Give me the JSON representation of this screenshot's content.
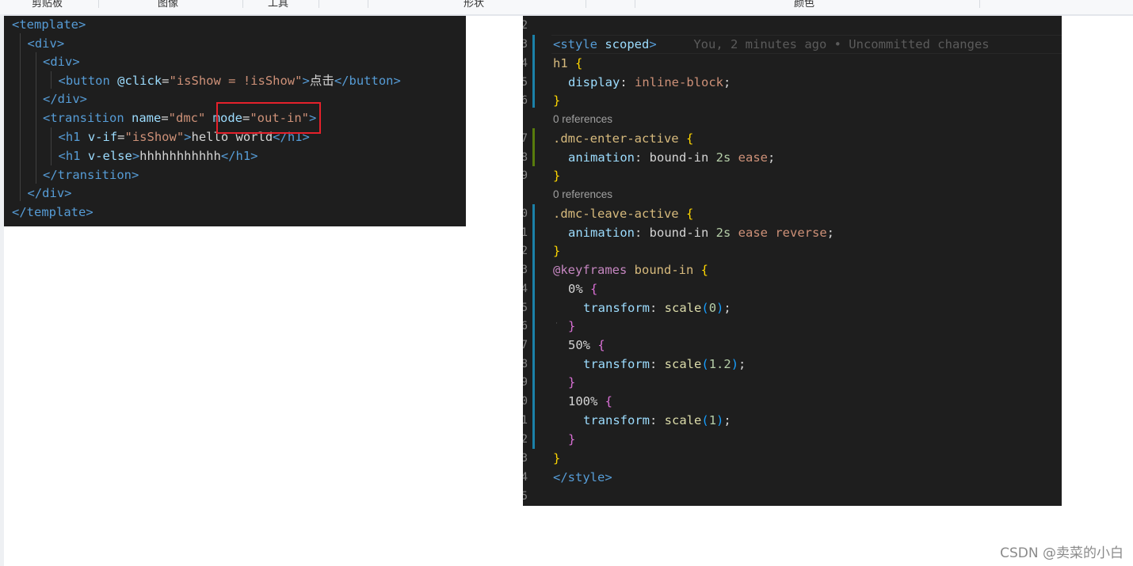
{
  "ribbon": {
    "labels": [
      "剪贴板",
      "图像",
      "工具",
      "形状",
      "颜色"
    ]
  },
  "left_editor": {
    "lines": [
      [
        [
          "tag",
          "<template>"
        ]
      ],
      [
        [
          "tag",
          "<div>"
        ]
      ],
      [
        [
          "tag",
          "<div>"
        ]
      ],
      [
        [
          "tag",
          "<button "
        ],
        [
          "attr",
          "@click"
        ],
        [
          "txt",
          "="
        ],
        [
          "str",
          "\"isShow = !isShow\""
        ],
        [
          "tag",
          ">"
        ],
        [
          "txt",
          "点击"
        ],
        [
          "tag",
          "</button>"
        ]
      ],
      [
        [
          "tag",
          "</div>"
        ]
      ],
      [
        [
          "tag",
          "<transition "
        ],
        [
          "attr",
          "name"
        ],
        [
          "txt",
          "="
        ],
        [
          "str",
          "\"dmc\" "
        ],
        [
          "attr",
          "mode"
        ],
        [
          "txt",
          "="
        ],
        [
          "str",
          "\"out-in\""
        ],
        [
          "tag",
          ">"
        ]
      ],
      [
        [
          "tag",
          "<h1 "
        ],
        [
          "attr",
          "v-if"
        ],
        [
          "txt",
          "="
        ],
        [
          "str",
          "\"isShow\""
        ],
        [
          "tag",
          ">"
        ],
        [
          "txt",
          "hello world"
        ],
        [
          "tag",
          "</h1>"
        ]
      ],
      [
        [
          "tag",
          "<h1 "
        ],
        [
          "attr",
          "v-else"
        ],
        [
          "tag",
          ">"
        ],
        [
          "txt",
          "hhhhhhhhhhh"
        ],
        [
          "tag",
          "</h1>"
        ]
      ],
      [
        [
          "tag",
          "</transition>"
        ]
      ],
      [
        [
          "tag",
          "</div>"
        ]
      ],
      [
        [
          "tag",
          "</template>"
        ]
      ]
    ],
    "highlighted_text": "mode=\"out-in\""
  },
  "right_editor": {
    "gutter": [
      "2",
      "3",
      "4",
      "5",
      "6",
      "",
      "7",
      "8",
      "9",
      "",
      "0",
      "1",
      "2",
      "3",
      "4",
      "5",
      "6",
      "7",
      "8",
      "9",
      "0",
      "1",
      "2",
      "3",
      "4",
      "5"
    ],
    "blame": "You, 2 minutes ago • Uncommitted changes",
    "codelens": "0 references",
    "lines": [
      [
        [
          "tag",
          "<style "
        ],
        [
          "attr",
          "scoped"
        ],
        [
          "tag",
          ">"
        ]
      ],
      [
        [
          "sel",
          "h1 "
        ],
        [
          "brace-y",
          "{"
        ]
      ],
      [
        [
          "prop",
          "display"
        ],
        [
          "txt",
          ": "
        ],
        [
          "val",
          "inline-block"
        ],
        [
          "txt",
          ";"
        ]
      ],
      [
        [
          "brace-y",
          "}"
        ]
      ],
      [
        [
          "sel",
          ".dmc-enter-active "
        ],
        [
          "brace-y",
          "{"
        ]
      ],
      [
        [
          "prop",
          "animation"
        ],
        [
          "txt",
          ": bound-in "
        ],
        [
          "num",
          "2s"
        ],
        [
          "txt",
          " "
        ],
        [
          "val",
          "ease"
        ],
        [
          "txt",
          ";"
        ]
      ],
      [
        [
          "brace-y",
          "}"
        ]
      ],
      [
        [
          "sel",
          ".dmc-leave-active "
        ],
        [
          "brace-y",
          "{"
        ]
      ],
      [
        [
          "prop",
          "animation"
        ],
        [
          "txt",
          ": bound-in "
        ],
        [
          "num",
          "2s"
        ],
        [
          "txt",
          " "
        ],
        [
          "val",
          "ease reverse"
        ],
        [
          "txt",
          ";"
        ]
      ],
      [
        [
          "brace-y",
          "}"
        ]
      ],
      [
        [
          "at",
          "@keyframes"
        ],
        [
          "txt",
          " "
        ],
        [
          "sel",
          "bound-in "
        ],
        [
          "brace-y",
          "{"
        ]
      ],
      [
        [
          "txt",
          "0% "
        ],
        [
          "brace-p",
          "{"
        ]
      ],
      [
        [
          "prop",
          "transform"
        ],
        [
          "txt",
          ": "
        ],
        [
          "fn",
          "scale"
        ],
        [
          "brace-b",
          "("
        ],
        [
          "num",
          "0"
        ],
        [
          "brace-b",
          ")"
        ],
        [
          "txt",
          ";"
        ]
      ],
      [
        [
          "brace-p",
          "}"
        ]
      ],
      [
        [
          "txt",
          "50% "
        ],
        [
          "brace-p",
          "{"
        ]
      ],
      [
        [
          "prop",
          "transform"
        ],
        [
          "txt",
          ": "
        ],
        [
          "fn",
          "scale"
        ],
        [
          "brace-b",
          "("
        ],
        [
          "num",
          "1.2"
        ],
        [
          "brace-b",
          ")"
        ],
        [
          "txt",
          ";"
        ]
      ],
      [
        [
          "brace-p",
          "}"
        ]
      ],
      [
        [
          "txt",
          "100% "
        ],
        [
          "brace-p",
          "{"
        ]
      ],
      [
        [
          "prop",
          "transform"
        ],
        [
          "txt",
          ": "
        ],
        [
          "fn",
          "scale"
        ],
        [
          "brace-b",
          "("
        ],
        [
          "num",
          "1"
        ],
        [
          "brace-b",
          ")"
        ],
        [
          "txt",
          ";"
        ]
      ],
      [
        [
          "brace-p",
          "}"
        ]
      ],
      [
        [
          "brace-y",
          "}"
        ]
      ],
      [
        [
          "tag",
          "</style>"
        ]
      ]
    ]
  },
  "watermark": "CSDN @卖菜的小白"
}
